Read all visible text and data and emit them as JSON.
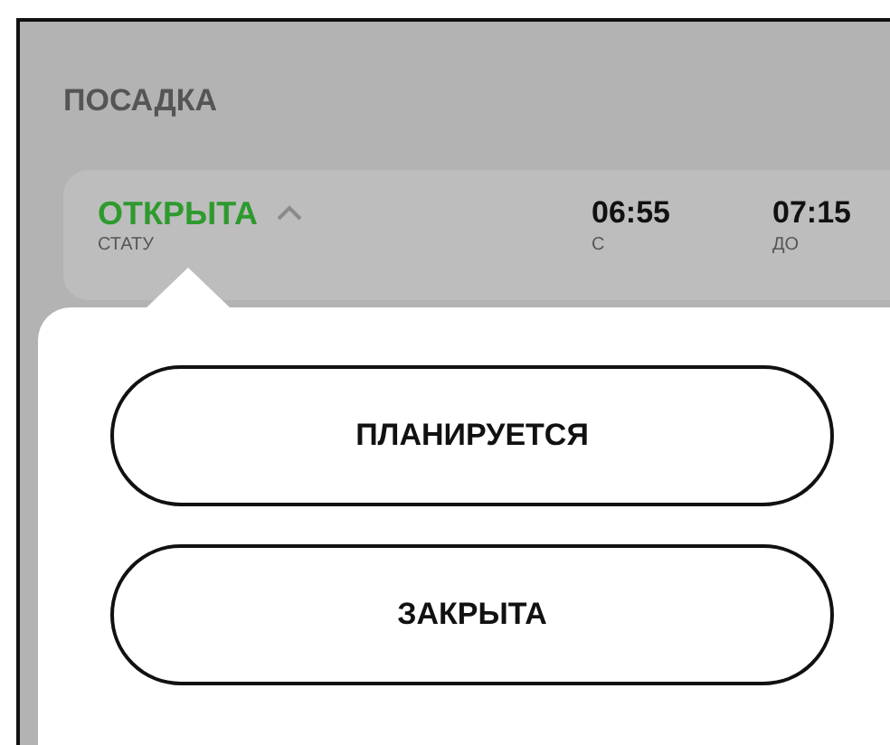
{
  "section_title": "ПОСАДКА",
  "status": {
    "value": "ОТКРЫТА",
    "label": "СТАТУ",
    "expanded": true
  },
  "times": [
    {
      "value": "06:55",
      "label": "С"
    },
    {
      "value": "07:15",
      "label": "ДО"
    }
  ],
  "options": [
    "ПЛАНИРУЕТСЯ",
    "ЗАКРЫТА"
  ]
}
